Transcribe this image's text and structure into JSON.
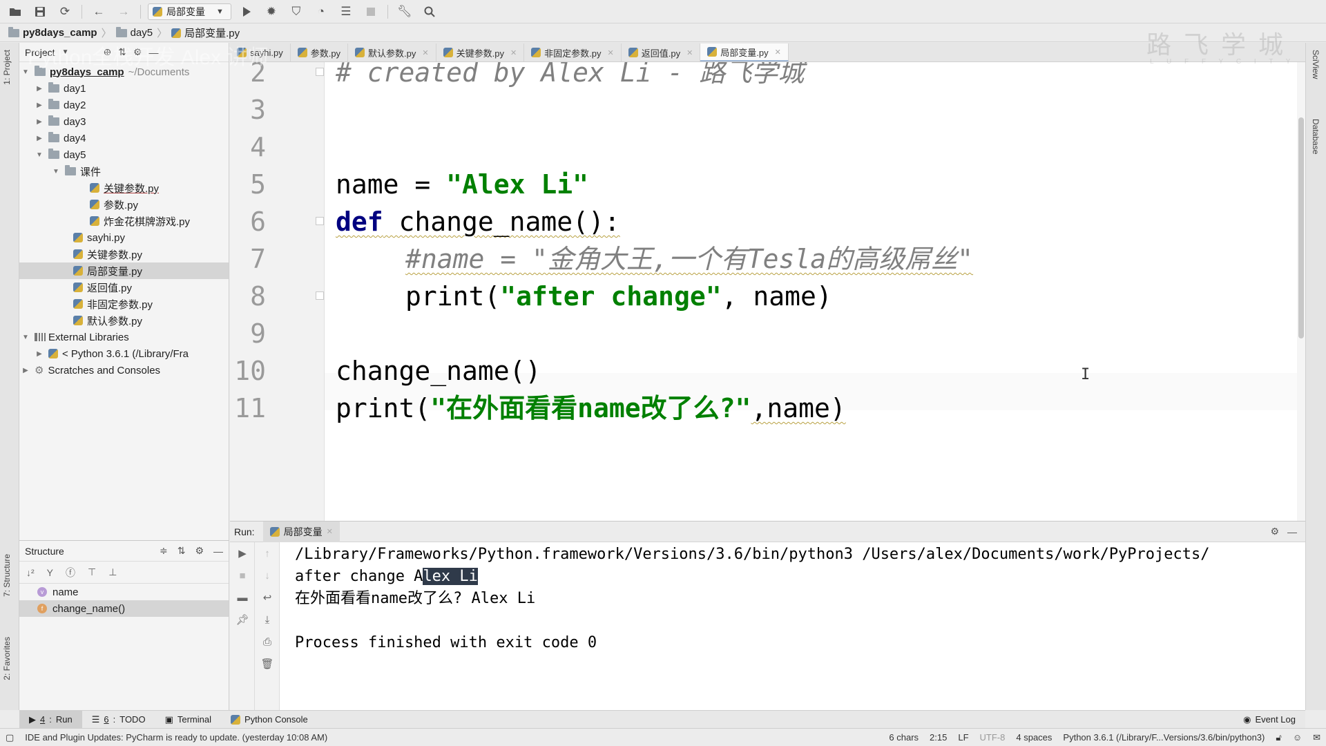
{
  "toolbar": {
    "run_config": "局部变量"
  },
  "breadcrumb": [
    "py8days_camp",
    "day5",
    "局部变量.py"
  ],
  "project": {
    "header": "Project",
    "root_name": "py8days_camp",
    "root_path": "~/Documents",
    "folders": [
      "day1",
      "day2",
      "day3",
      "day4",
      "day5"
    ],
    "subfolder": "课件",
    "subfolder_files": [
      "关键参数.py",
      "参数.py",
      "炸金花棋牌游戏.py"
    ],
    "files": [
      "sayhi.py",
      "关键参数.py",
      "局部变量.py",
      "返回值.py",
      "非固定参数.py",
      "默认参数.py"
    ],
    "external": "External Libraries",
    "python_sdk": "< Python 3.6.1 (/Library/Fra",
    "scratches": "Scratches and Consoles"
  },
  "structure": {
    "title": "Structure",
    "items": [
      "name",
      "change_name()"
    ]
  },
  "tabs": [
    "sayhi.py",
    "参数.py",
    "默认参数.py",
    "关键参数.py",
    "非固定参数.py",
    "返回值.py",
    "局部变量.py"
  ],
  "editor": {
    "line_numbers": [
      "2",
      "3",
      "4",
      "5",
      "6",
      "7",
      "8",
      "9",
      "10",
      "11"
    ],
    "line2": "# created by Alex Li - 路飞学城",
    "line5_a": "name = ",
    "line5_b": "\"Alex Li\"",
    "line6_kw": "def",
    "line6_rest": " change_name():",
    "line7": "#name = \"金角大王,一个有Tesla的高级屌丝\"",
    "line8_a": "print(",
    "line8_b": "\"after change\"",
    "line8_c": ", name)",
    "line10": "change_name()",
    "line11_a": "print(",
    "line11_b": "\"在外面看看name改了么?\"",
    "line11_c": ",name)"
  },
  "run": {
    "label": "Run:",
    "tab": "局部变量",
    "line1": "/Library/Frameworks/Python.framework/Versions/3.6/bin/python3 /Users/alex/Documents/work/PyProjects/",
    "line2_a": "after change A",
    "line2_b": "lex Li",
    "line3": "在外面看看name改了么? Alex Li",
    "line5": "Process finished with exit code 0"
  },
  "tool_windows": [
    {
      "num": "4",
      "label": "Run"
    },
    {
      "num": "6",
      "label": "TODO"
    },
    {
      "num": "",
      "label": "Terminal"
    },
    {
      "num": "",
      "label": "Python Console"
    }
  ],
  "event_log": "Event Log",
  "side_tabs": {
    "project": "1: Project",
    "structure": "7: Structure",
    "favorites": "2: Favorites",
    "sciview": "SciView",
    "database": "Database"
  },
  "status": {
    "message": "IDE and Plugin Updates: PyCharm is ready to update. (yesterday 10:08 AM)",
    "chars": "6 chars",
    "position": "2:15",
    "line_sep": "LF",
    "encoding": "UTF-8",
    "indent": "4 spaces",
    "interpreter": "Python 3.6.1 (/Library/F...Versions/3.6/bin/python3)"
  },
  "watermark": {
    "top_right": "路 飞 学 城",
    "top_right_sub": "L U F F Y C I T Y",
    "overlay": "Python全栈开发 Alex 讲师"
  }
}
